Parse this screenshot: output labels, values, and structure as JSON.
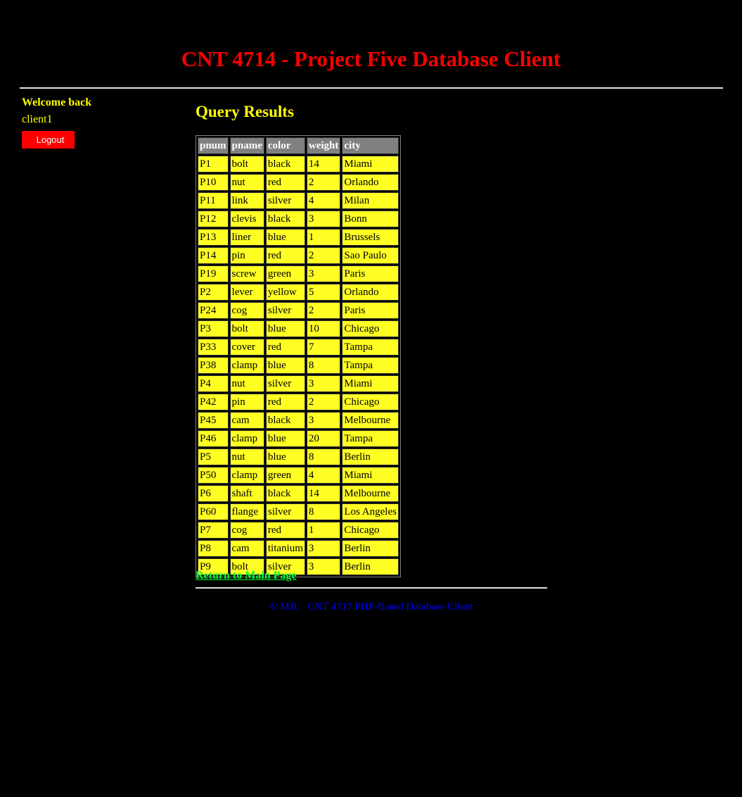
{
  "header": {
    "title": "CNT 4714 - Project Five Database Client"
  },
  "sidebar": {
    "welcome": "Welcome back",
    "username": "client1",
    "logout_label": "Logout"
  },
  "main": {
    "title": "Query Results",
    "columns": [
      "pnum",
      "pname",
      "color",
      "weight",
      "city"
    ],
    "rows": [
      [
        "P1",
        "bolt",
        "black",
        "14",
        "Miami"
      ],
      [
        "P10",
        "nut",
        "red",
        "2",
        "Orlando"
      ],
      [
        "P11",
        "link",
        "silver",
        "4",
        "Milan"
      ],
      [
        "P12",
        "clevis",
        "black",
        "3",
        "Bonn"
      ],
      [
        "P13",
        "liner",
        "blue",
        "1",
        "Brussels"
      ],
      [
        "P14",
        "pin",
        "red",
        "2",
        "Sao Paulo"
      ],
      [
        "P19",
        "screw",
        "green",
        "3",
        "Paris"
      ],
      [
        "P2",
        "lever",
        "yellow",
        "5",
        "Orlando"
      ],
      [
        "P24",
        "cog",
        "silver",
        "2",
        "Paris"
      ],
      [
        "P3",
        "bolt",
        "blue",
        "10",
        "Chicago"
      ],
      [
        "P33",
        "cover",
        "red",
        "7",
        "Tampa"
      ],
      [
        "P38",
        "clamp",
        "blue",
        "8",
        "Tampa"
      ],
      [
        "P4",
        "nut",
        "silver",
        "3",
        "Miami"
      ],
      [
        "P42",
        "pin",
        "red",
        "2",
        "Chicago"
      ],
      [
        "P45",
        "cam",
        "black",
        "3",
        "Melbourne"
      ],
      [
        "P46",
        "clamp",
        "blue",
        "20",
        "Tampa"
      ],
      [
        "P5",
        "nut",
        "blue",
        "8",
        "Berlin"
      ],
      [
        "P50",
        "clamp",
        "green",
        "4",
        "Miami"
      ],
      [
        "P6",
        "shaft",
        "black",
        "14",
        "Melbourne"
      ],
      [
        "P60",
        "flange",
        "silver",
        "8",
        "Los Angeles"
      ],
      [
        "P7",
        "cog",
        "red",
        "1",
        "Chicago"
      ],
      [
        "P8",
        "cam",
        "titanium",
        "3",
        "Berlin"
      ],
      [
        "P9",
        "bolt",
        "silver",
        "3",
        "Berlin"
      ]
    ],
    "return_link": "Return to Main Page"
  },
  "footer": {
    "text": "© MJL   CNT 4717 PHP-Based Database Client"
  },
  "colors": {
    "background": "#000000",
    "title": "#ff0000",
    "accent_text": "#ffff00",
    "cell_background": "#ffff24",
    "header_cell_background": "#808080",
    "logout_background": "#ff0000",
    "link": "#00ff33",
    "footer_text": "#0000ff"
  }
}
